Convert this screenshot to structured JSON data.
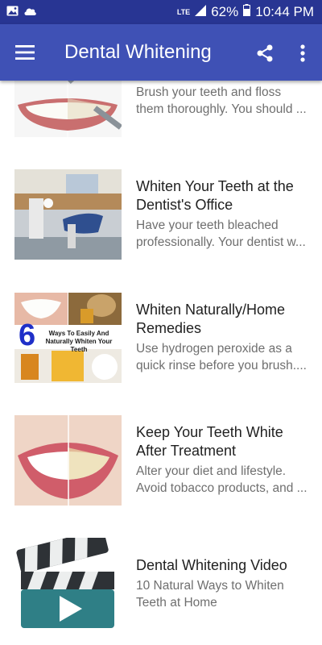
{
  "status_bar": {
    "left_icons": [
      "image-icon",
      "cloud-icon"
    ],
    "network": "LTE",
    "battery": "62%",
    "time": "10:44 PM"
  },
  "app_bar": {
    "title": "Dental Whitening",
    "icons": [
      "menu-icon",
      "share-icon",
      "more-vert-icon"
    ]
  },
  "colors": {
    "status_bar": "#283593",
    "app_bar": "#3f51b5",
    "title_text": "#212121",
    "desc_text": "#6f6f6f"
  },
  "items": [
    {
      "title": "",
      "desc": "Brush your teeth and floss them thoroughly. You should ...",
      "image": "teeth-brushing-tools-photo"
    },
    {
      "title": "Whiten Your Teeth at the Dentist's Office",
      "desc": "Have your teeth bleached professionally. Your dentist w...",
      "image": "dentist-office-photo"
    },
    {
      "title": "Whiten Naturally/Home Remedies",
      "desc": "Use hydrogen peroxide as a quick rinse before you brush....",
      "image": "home-remedies-collage",
      "image_text": {
        "number": "6",
        "caption": "Ways To Easily And Naturally Whiten Your Teeth"
      }
    },
    {
      "title": "Keep Your Teeth White After Treatment",
      "desc": "Alter your diet and lifestyle. Avoid tobacco products, and ...",
      "image": "before-after-smile-photo"
    },
    {
      "title": "Dental Whitening Video",
      "desc": "10 Natural Ways to Whiten Teeth at Home",
      "image": "video-clapperboard-icon"
    }
  ]
}
